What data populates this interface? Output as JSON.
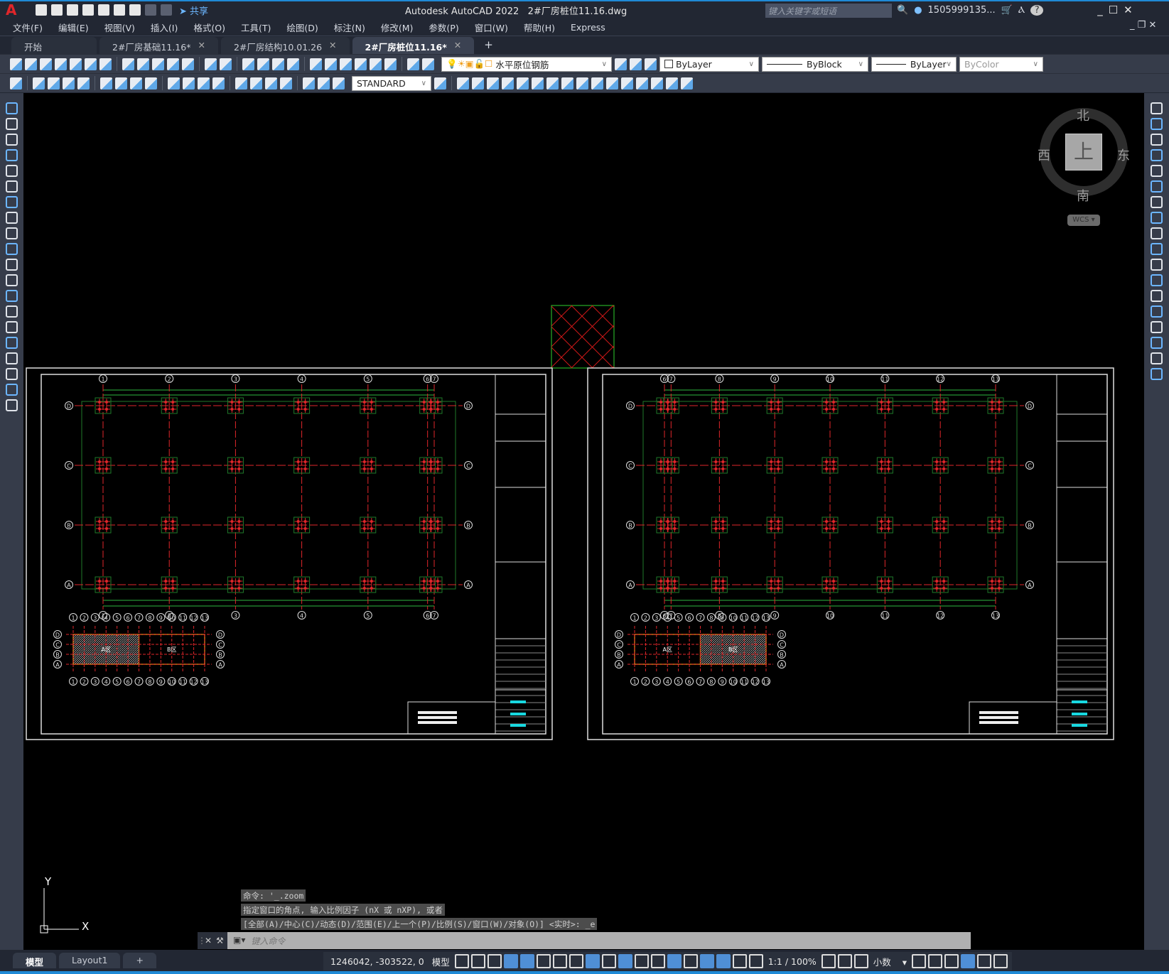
{
  "app": {
    "title": "Autodesk AutoCAD 2022",
    "file": "2#厂房桩位11.16.dwg",
    "logo": "A",
    "share_label": "共享",
    "search_placeholder": "键入关键字或短语",
    "user": "1505999135...",
    "colors": {
      "accent": "#1f8ad6",
      "canvas": "#000000",
      "axis": "#e0262a",
      "dim": "#1f7a2a"
    }
  },
  "menu": [
    "文件(F)",
    "编辑(E)",
    "视图(V)",
    "插入(I)",
    "格式(O)",
    "工具(T)",
    "绘图(D)",
    "标注(N)",
    "修改(M)",
    "参数(P)",
    "窗口(W)",
    "帮助(H)",
    "Express"
  ],
  "tabs": [
    {
      "label": "开始",
      "close": ""
    },
    {
      "label": "2#厂房基础11.16*",
      "close": "✕"
    },
    {
      "label": "2#厂房结构10.01.26",
      "close": "✕"
    },
    {
      "label": "2#厂房桩位11.16*",
      "close": "✕",
      "active": true
    }
  ],
  "new_tab": "+",
  "toolbar": {
    "row1_icons": [
      "new-icon",
      "open-icon",
      "save-icon",
      "print-icon",
      "plot-preview-icon",
      "publish-icon",
      "3d-print-icon",
      "cut-icon",
      "copy-icon",
      "paste-icon",
      "match-properties-icon",
      "block-editor-icon",
      "undo-icon",
      "redo-icon",
      "pan-icon",
      "zoom-realtime-icon",
      "zoom-window-icon",
      "zoom-previous-icon",
      "properties-icon",
      "design-center-icon",
      "tool-palettes-icon",
      "sheet-set-icon",
      "markup-icon",
      "calculator-icon",
      "help-icon",
      "layer-properties-icon"
    ],
    "layer": "水平原位钢筋",
    "color": "ByLayer",
    "linetype": "ByBlock",
    "lineweight": "ByLayer",
    "plotstyle": "ByColor",
    "row2_icons": [
      "dim-linear-icon",
      "dim-aligned-icon",
      "dim-arc-icon",
      "dim-ordinate-icon",
      "dim-radius-icon",
      "dim-jogged-icon",
      "dim-diameter-icon",
      "dim-angular-icon",
      "quick-dim-icon",
      "baseline-icon",
      "continue-icon",
      "dim-space-icon",
      "dim-break-icon",
      "tolerance-icon",
      "center-mark-icon",
      "inspection-icon",
      "jogged-linear-icon",
      "dim-edit-icon",
      "dim-text-edit-icon",
      "dim-update-icon"
    ],
    "dimstyle": "STANDARD",
    "row2b_icons": [
      "union-icon",
      "subtract-icon",
      "intersect-icon",
      "extrude-faces-icon",
      "move-faces-icon",
      "offset-faces-icon",
      "delete-faces-icon",
      "rotate-faces-icon",
      "taper-faces-icon",
      "copy-faces-icon",
      "color-faces-icon",
      "imprint-icon",
      "clean-icon",
      "separate-icon",
      "shell-icon",
      "check-icon"
    ]
  },
  "left_tools": [
    "line-icon",
    "construction-line-icon",
    "polyline-icon",
    "polygon-icon",
    "rectangle-icon",
    "arc-icon",
    "circle-icon",
    "revision-cloud-icon",
    "spline-icon",
    "ellipse-icon",
    "ellipse-arc-icon",
    "insert-block-icon",
    "make-block-icon",
    "point-icon",
    "hatch-icon",
    "gradient-icon",
    "region-icon",
    "table-icon",
    "multiline-text-icon",
    "add-selected-icon"
  ],
  "right_tools": [
    "erase-icon",
    "copy-object-icon",
    "mirror-icon",
    "offset-icon",
    "array-icon",
    "move-icon",
    "rotate-icon",
    "scale-icon",
    "stretch-icon",
    "trim-icon",
    "extend-icon",
    "break-at-point-icon",
    "break-icon",
    "join-icon",
    "chamfer-icon",
    "fillet-icon",
    "blend-curves-icon",
    "explode-icon"
  ],
  "viewcube": {
    "north": "北",
    "south": "南",
    "east": "东",
    "west": "西",
    "face": "上",
    "wcs": "WCS"
  },
  "ucs": {
    "x": "X",
    "y": "Y"
  },
  "drawings": [
    {
      "cols": [
        "1",
        "2",
        "3",
        "4",
        "5",
        "6",
        "7"
      ],
      "rows": [
        "D",
        "C",
        "B",
        "A"
      ],
      "key_cols": [
        "1",
        "2",
        "3",
        "4",
        "5",
        "6",
        "7",
        "8",
        "9",
        "10",
        "11",
        "12",
        "13"
      ],
      "zone_a": "A区",
      "zone_b": "B区",
      "hatched": "A"
    },
    {
      "cols": [
        "6",
        "7",
        "8",
        "9",
        "10",
        "11",
        "12",
        "13"
      ],
      "rows": [
        "D",
        "C",
        "B",
        "A"
      ],
      "key_cols": [
        "1",
        "2",
        "3",
        "4",
        "5",
        "6",
        "7",
        "8",
        "9",
        "10",
        "11",
        "12",
        "13"
      ],
      "zone_a": "A区",
      "zone_b": "B区",
      "hatched": "B"
    }
  ],
  "command": {
    "history": [
      "命令: '_.zoom",
      "指定窗口的角点, 输入比例因子 (nX 或 nXP), 或者",
      "[全部(A)/中心(C)/动态(D)/范围(E)/上一个(P)/比例(S)/窗口(W)/对象(O)] <实时>: _e"
    ],
    "placeholder": "键入命令"
  },
  "layout_tabs": [
    "模型",
    "Layout1",
    "+"
  ],
  "status": {
    "coords": "1246042, -303522, 0",
    "space": "模型",
    "scale": "1:1 / 100%",
    "units": "小数"
  }
}
